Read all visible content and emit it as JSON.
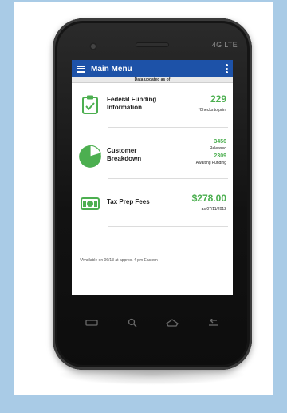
{
  "device": {
    "network_label": "4G LTE"
  },
  "app": {
    "title": "Main Menu",
    "date_bar": "Data updated as of"
  },
  "rows": [
    {
      "label_line1": "Federal Funding",
      "label_line2": "Information",
      "value": "229",
      "sub": "*Checks to print",
      "icon": "clipboard-icon",
      "accent": "#4caf50"
    },
    {
      "label_line1": "Customer",
      "label_line2": "Breakdown",
      "value_a": "3456",
      "sub_a": "Released",
      "value_b": "2309",
      "sub_b": "Awaiting Funding",
      "icon": "pie-chart-icon",
      "accent": "#4caf50"
    },
    {
      "label_line1": "Tax Prep Fees",
      "value": "$278.00",
      "sub": "as 07/11/2012",
      "icon": "dollar-bill-icon",
      "accent": "#4caf50"
    }
  ],
  "footnote": "*Available on 06/13 at approx. 4 pm Eastern",
  "nav": {
    "recent": "recent-apps-icon",
    "search": "search-icon",
    "home": "home-icon",
    "back": "back-icon"
  },
  "colors": {
    "appbar": "#1d52a8",
    "accent": "#4caf50",
    "frame": "#a9cbe6"
  }
}
